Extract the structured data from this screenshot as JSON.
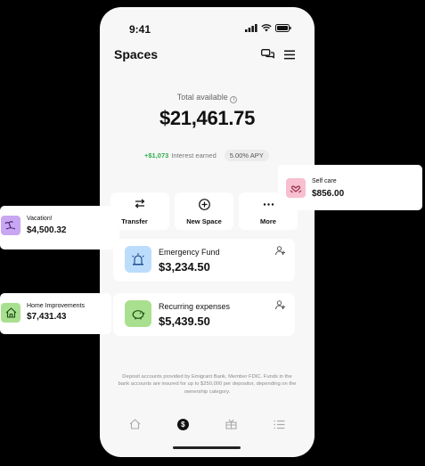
{
  "status_bar": {
    "time": "9:41"
  },
  "header": {
    "title": "Spaces"
  },
  "summary": {
    "total_label": "Total available",
    "total_amount": "$21,461.75",
    "interest_amount": "+$1,073",
    "interest_label": "Interest earned",
    "apy": "5.00% APY"
  },
  "actions": [
    {
      "label": "Transfer",
      "icon": "transfer-arrows-icon"
    },
    {
      "label": "New Space",
      "icon": "plus-circle-icon"
    },
    {
      "label": "More",
      "icon": "more-dots-icon"
    }
  ],
  "spaces": [
    {
      "name": "Emergency Fund",
      "amount": "$3,234.50",
      "icon": "siren-icon",
      "color": "#bcdcfb"
    },
    {
      "name": "Recurring expenses",
      "amount": "$5,439.50",
      "icon": "piggy-bank-icon",
      "color": "#a9e08f"
    }
  ],
  "floating_spaces": [
    {
      "name": "Self care",
      "amount": "$856.00",
      "icon": "heart-hands-icon",
      "color": "#f7bfcf"
    },
    {
      "name": "Vacation!",
      "amount": "$4,500.32",
      "icon": "beach-icon",
      "color": "#c9a6f2"
    },
    {
      "name": "Home Improvements",
      "amount": "$7,431.43",
      "icon": "house-icon",
      "color": "#a9e08f"
    }
  ],
  "disclaimer": "Deposit accounts provided by Emigrant Bank, Member FDIC. Funds in the bank accounts are insured for up to $250,000 per depositor, depending on the ownership category.",
  "tabbar": [
    {
      "icon": "home-icon"
    },
    {
      "icon": "dollar-coin-icon",
      "label": "$"
    },
    {
      "icon": "gift-icon"
    },
    {
      "icon": "list-icon"
    }
  ]
}
